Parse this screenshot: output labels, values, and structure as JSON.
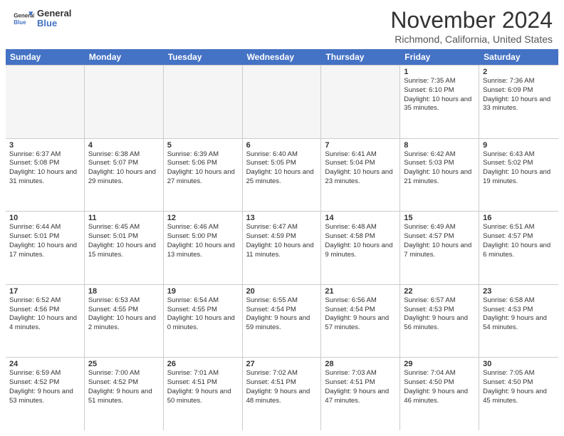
{
  "header": {
    "logo_line1": "General",
    "logo_line2": "Blue",
    "month": "November 2024",
    "location": "Richmond, California, United States"
  },
  "weekdays": [
    "Sunday",
    "Monday",
    "Tuesday",
    "Wednesday",
    "Thursday",
    "Friday",
    "Saturday"
  ],
  "weeks": [
    [
      {
        "day": "",
        "empty": true
      },
      {
        "day": "",
        "empty": true
      },
      {
        "day": "",
        "empty": true
      },
      {
        "day": "",
        "empty": true
      },
      {
        "day": "",
        "empty": true
      },
      {
        "day": "1",
        "sunrise": "Sunrise: 7:35 AM",
        "sunset": "Sunset: 6:10 PM",
        "daylight": "Daylight: 10 hours and 35 minutes."
      },
      {
        "day": "2",
        "sunrise": "Sunrise: 7:36 AM",
        "sunset": "Sunset: 6:09 PM",
        "daylight": "Daylight: 10 hours and 33 minutes."
      }
    ],
    [
      {
        "day": "3",
        "sunrise": "Sunrise: 6:37 AM",
        "sunset": "Sunset: 5:08 PM",
        "daylight": "Daylight: 10 hours and 31 minutes."
      },
      {
        "day": "4",
        "sunrise": "Sunrise: 6:38 AM",
        "sunset": "Sunset: 5:07 PM",
        "daylight": "Daylight: 10 hours and 29 minutes."
      },
      {
        "day": "5",
        "sunrise": "Sunrise: 6:39 AM",
        "sunset": "Sunset: 5:06 PM",
        "daylight": "Daylight: 10 hours and 27 minutes."
      },
      {
        "day": "6",
        "sunrise": "Sunrise: 6:40 AM",
        "sunset": "Sunset: 5:05 PM",
        "daylight": "Daylight: 10 hours and 25 minutes."
      },
      {
        "day": "7",
        "sunrise": "Sunrise: 6:41 AM",
        "sunset": "Sunset: 5:04 PM",
        "daylight": "Daylight: 10 hours and 23 minutes."
      },
      {
        "day": "8",
        "sunrise": "Sunrise: 6:42 AM",
        "sunset": "Sunset: 5:03 PM",
        "daylight": "Daylight: 10 hours and 21 minutes."
      },
      {
        "day": "9",
        "sunrise": "Sunrise: 6:43 AM",
        "sunset": "Sunset: 5:02 PM",
        "daylight": "Daylight: 10 hours and 19 minutes."
      }
    ],
    [
      {
        "day": "10",
        "sunrise": "Sunrise: 6:44 AM",
        "sunset": "Sunset: 5:01 PM",
        "daylight": "Daylight: 10 hours and 17 minutes."
      },
      {
        "day": "11",
        "sunrise": "Sunrise: 6:45 AM",
        "sunset": "Sunset: 5:01 PM",
        "daylight": "Daylight: 10 hours and 15 minutes."
      },
      {
        "day": "12",
        "sunrise": "Sunrise: 6:46 AM",
        "sunset": "Sunset: 5:00 PM",
        "daylight": "Daylight: 10 hours and 13 minutes."
      },
      {
        "day": "13",
        "sunrise": "Sunrise: 6:47 AM",
        "sunset": "Sunset: 4:59 PM",
        "daylight": "Daylight: 10 hours and 11 minutes."
      },
      {
        "day": "14",
        "sunrise": "Sunrise: 6:48 AM",
        "sunset": "Sunset: 4:58 PM",
        "daylight": "Daylight: 10 hours and 9 minutes."
      },
      {
        "day": "15",
        "sunrise": "Sunrise: 6:49 AM",
        "sunset": "Sunset: 4:57 PM",
        "daylight": "Daylight: 10 hours and 7 minutes."
      },
      {
        "day": "16",
        "sunrise": "Sunrise: 6:51 AM",
        "sunset": "Sunset: 4:57 PM",
        "daylight": "Daylight: 10 hours and 6 minutes."
      }
    ],
    [
      {
        "day": "17",
        "sunrise": "Sunrise: 6:52 AM",
        "sunset": "Sunset: 4:56 PM",
        "daylight": "Daylight: 10 hours and 4 minutes."
      },
      {
        "day": "18",
        "sunrise": "Sunrise: 6:53 AM",
        "sunset": "Sunset: 4:55 PM",
        "daylight": "Daylight: 10 hours and 2 minutes."
      },
      {
        "day": "19",
        "sunrise": "Sunrise: 6:54 AM",
        "sunset": "Sunset: 4:55 PM",
        "daylight": "Daylight: 10 hours and 0 minutes."
      },
      {
        "day": "20",
        "sunrise": "Sunrise: 6:55 AM",
        "sunset": "Sunset: 4:54 PM",
        "daylight": "Daylight: 9 hours and 59 minutes."
      },
      {
        "day": "21",
        "sunrise": "Sunrise: 6:56 AM",
        "sunset": "Sunset: 4:54 PM",
        "daylight": "Daylight: 9 hours and 57 minutes."
      },
      {
        "day": "22",
        "sunrise": "Sunrise: 6:57 AM",
        "sunset": "Sunset: 4:53 PM",
        "daylight": "Daylight: 9 hours and 56 minutes."
      },
      {
        "day": "23",
        "sunrise": "Sunrise: 6:58 AM",
        "sunset": "Sunset: 4:53 PM",
        "daylight": "Daylight: 9 hours and 54 minutes."
      }
    ],
    [
      {
        "day": "24",
        "sunrise": "Sunrise: 6:59 AM",
        "sunset": "Sunset: 4:52 PM",
        "daylight": "Daylight: 9 hours and 53 minutes."
      },
      {
        "day": "25",
        "sunrise": "Sunrise: 7:00 AM",
        "sunset": "Sunset: 4:52 PM",
        "daylight": "Daylight: 9 hours and 51 minutes."
      },
      {
        "day": "26",
        "sunrise": "Sunrise: 7:01 AM",
        "sunset": "Sunset: 4:51 PM",
        "daylight": "Daylight: 9 hours and 50 minutes."
      },
      {
        "day": "27",
        "sunrise": "Sunrise: 7:02 AM",
        "sunset": "Sunset: 4:51 PM",
        "daylight": "Daylight: 9 hours and 48 minutes."
      },
      {
        "day": "28",
        "sunrise": "Sunrise: 7:03 AM",
        "sunset": "Sunset: 4:51 PM",
        "daylight": "Daylight: 9 hours and 47 minutes."
      },
      {
        "day": "29",
        "sunrise": "Sunrise: 7:04 AM",
        "sunset": "Sunset: 4:50 PM",
        "daylight": "Daylight: 9 hours and 46 minutes."
      },
      {
        "day": "30",
        "sunrise": "Sunrise: 7:05 AM",
        "sunset": "Sunset: 4:50 PM",
        "daylight": "Daylight: 9 hours and 45 minutes."
      }
    ]
  ]
}
